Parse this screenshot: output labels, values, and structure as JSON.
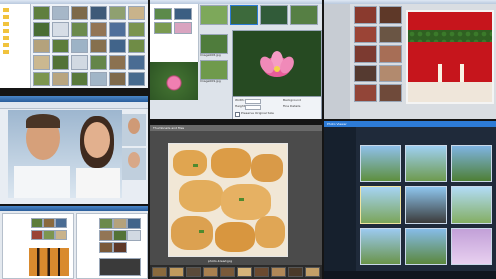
{
  "screens": {
    "top_left": {
      "files": [
        {
          "name": "Image001.jpg"
        },
        {
          "name": "Image002.jpg"
        },
        {
          "name": "Image003.jpg"
        },
        {
          "name": "Image004.jpg"
        },
        {
          "name": "Image005.jpg"
        },
        {
          "name": "Image006.jpg"
        },
        {
          "name": "Image007.jpg"
        },
        {
          "name": "Image008.jpg"
        },
        {
          "name": "Image009.jpg"
        },
        {
          "name": "Image010.jpg"
        }
      ]
    },
    "middle_top": {
      "file_labels": [
        "Image008.jpg",
        "Image009.jpg"
      ],
      "dialog": {
        "width_label": "Width:",
        "height_label": "Height:",
        "button_1": "Background",
        "button_2": "Fine Details",
        "checkbox": "Preserve Original Size"
      }
    },
    "bottom_middle": {
      "title": "Thumbnails and files",
      "status": "photo-bread.jpg"
    },
    "bottom_right": {
      "title": "Photo Viewer"
    }
  },
  "colors": {
    "accent": "#2d7bd6",
    "dark_panel": "#1f2a3a",
    "lotus_pink": "#e85c9a"
  }
}
